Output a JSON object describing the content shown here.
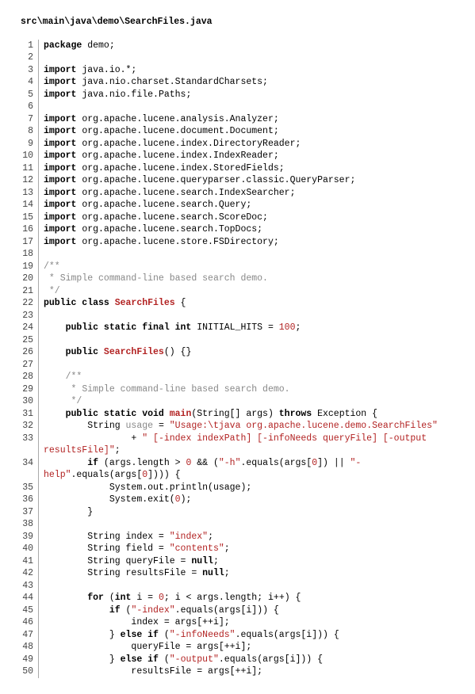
{
  "filePath": "src\\main\\java\\demo\\SearchFiles.java",
  "code": {
    "lines": [
      {
        "n": 1,
        "segs": [
          {
            "t": "package",
            "c": "kw"
          },
          {
            "t": " demo;"
          }
        ]
      },
      {
        "n": 2,
        "segs": []
      },
      {
        "n": 3,
        "segs": [
          {
            "t": "import",
            "c": "kw"
          },
          {
            "t": " java.io.*;"
          }
        ]
      },
      {
        "n": 4,
        "segs": [
          {
            "t": "import",
            "c": "kw"
          },
          {
            "t": " java.nio.charset.StandardCharsets;"
          }
        ]
      },
      {
        "n": 5,
        "segs": [
          {
            "t": "import",
            "c": "kw"
          },
          {
            "t": " java.nio.file.Paths;"
          }
        ]
      },
      {
        "n": 6,
        "segs": []
      },
      {
        "n": 7,
        "segs": [
          {
            "t": "import",
            "c": "kw"
          },
          {
            "t": " org.apache.lucene.analysis.Analyzer;"
          }
        ]
      },
      {
        "n": 8,
        "segs": [
          {
            "t": "import",
            "c": "kw"
          },
          {
            "t": " org.apache.lucene.document.Document;"
          }
        ]
      },
      {
        "n": 9,
        "segs": [
          {
            "t": "import",
            "c": "kw"
          },
          {
            "t": " org.apache.lucene.index.DirectoryReader;"
          }
        ]
      },
      {
        "n": 10,
        "segs": [
          {
            "t": "import",
            "c": "kw"
          },
          {
            "t": " org.apache.lucene.index.IndexReader;"
          }
        ]
      },
      {
        "n": 11,
        "segs": [
          {
            "t": "import",
            "c": "kw"
          },
          {
            "t": " org.apache.lucene.index.StoredFields;"
          }
        ]
      },
      {
        "n": 12,
        "segs": [
          {
            "t": "import",
            "c": "kw"
          },
          {
            "t": " org.apache.lucene.queryparser.classic.QueryParser;"
          }
        ]
      },
      {
        "n": 13,
        "segs": [
          {
            "t": "import",
            "c": "kw"
          },
          {
            "t": " org.apache.lucene.search.IndexSearcher;"
          }
        ]
      },
      {
        "n": 14,
        "segs": [
          {
            "t": "import",
            "c": "kw"
          },
          {
            "t": " org.apache.lucene.search.Query;"
          }
        ]
      },
      {
        "n": 15,
        "segs": [
          {
            "t": "import",
            "c": "kw"
          },
          {
            "t": " org.apache.lucene.search.ScoreDoc;"
          }
        ]
      },
      {
        "n": 16,
        "segs": [
          {
            "t": "import",
            "c": "kw"
          },
          {
            "t": " org.apache.lucene.search.TopDocs;"
          }
        ]
      },
      {
        "n": 17,
        "segs": [
          {
            "t": "import",
            "c": "kw"
          },
          {
            "t": " org.apache.lucene.store.FSDirectory;"
          }
        ]
      },
      {
        "n": 18,
        "segs": []
      },
      {
        "n": 19,
        "segs": [
          {
            "t": "/**",
            "c": "cmt"
          }
        ]
      },
      {
        "n": 20,
        "segs": [
          {
            "t": " * Simple command-line based search demo.",
            "c": "cmt"
          }
        ]
      },
      {
        "n": 21,
        "segs": [
          {
            "t": " */",
            "c": "cmt"
          }
        ]
      },
      {
        "n": 22,
        "segs": [
          {
            "t": "public class ",
            "c": "kw"
          },
          {
            "t": "SearchFiles",
            "c": "cname"
          },
          {
            "t": " {"
          }
        ]
      },
      {
        "n": 23,
        "segs": []
      },
      {
        "n": 24,
        "segs": [
          {
            "t": "    "
          },
          {
            "t": "public static final int",
            "c": "kw"
          },
          {
            "t": " INITIAL_HITS = "
          },
          {
            "t": "100",
            "c": "num"
          },
          {
            "t": ";"
          }
        ]
      },
      {
        "n": 25,
        "segs": []
      },
      {
        "n": 26,
        "segs": [
          {
            "t": "    "
          },
          {
            "t": "public ",
            "c": "kw"
          },
          {
            "t": "SearchFiles",
            "c": "cname"
          },
          {
            "t": "() {}"
          }
        ]
      },
      {
        "n": 27,
        "segs": []
      },
      {
        "n": 28,
        "segs": [
          {
            "t": "    "
          },
          {
            "t": "/**",
            "c": "cmt"
          }
        ]
      },
      {
        "n": 29,
        "segs": [
          {
            "t": "     * Simple command-line based search demo.",
            "c": "cmt"
          }
        ]
      },
      {
        "n": 30,
        "segs": [
          {
            "t": "     */",
            "c": "cmt"
          }
        ]
      },
      {
        "n": 31,
        "segs": [
          {
            "t": "    "
          },
          {
            "t": "public static void ",
            "c": "kw"
          },
          {
            "t": "main",
            "c": "cname"
          },
          {
            "t": "(String[] args) "
          },
          {
            "t": "throws",
            "c": "kw"
          },
          {
            "t": " Exception {"
          }
        ]
      },
      {
        "n": 32,
        "segs": [
          {
            "t": "        String "
          },
          {
            "t": "usage",
            "c": "cmt"
          },
          {
            "t": " = "
          },
          {
            "t": "\"Usage:\\tjava org.apache.lucene.demo.SearchFiles\"",
            "c": "str"
          }
        ]
      },
      {
        "n": 33,
        "segs": [
          {
            "t": "                + "
          },
          {
            "t": "\" [-index indexPath] [-infoNeeds queryFile] [-output resultsFile]\"",
            "c": "str"
          },
          {
            "t": ";"
          }
        ]
      },
      {
        "n": 34,
        "segs": [
          {
            "t": "        "
          },
          {
            "t": "if",
            "c": "kw"
          },
          {
            "t": " (args.length > "
          },
          {
            "t": "0",
            "c": "num"
          },
          {
            "t": " && ("
          },
          {
            "t": "\"-h\"",
            "c": "str"
          },
          {
            "t": ".equals(args["
          },
          {
            "t": "0",
            "c": "num"
          },
          {
            "t": "]) || "
          },
          {
            "t": "\"-help\"",
            "c": "str"
          },
          {
            "t": ".equals(args["
          },
          {
            "t": "0",
            "c": "num"
          },
          {
            "t": "]))) {"
          }
        ]
      },
      {
        "n": 35,
        "segs": [
          {
            "t": "            System.out.println(usage);"
          }
        ]
      },
      {
        "n": 36,
        "segs": [
          {
            "t": "            System.exit("
          },
          {
            "t": "0",
            "c": "num"
          },
          {
            "t": ");"
          }
        ]
      },
      {
        "n": 37,
        "segs": [
          {
            "t": "        }"
          }
        ]
      },
      {
        "n": 38,
        "segs": []
      },
      {
        "n": 39,
        "segs": [
          {
            "t": "        String index = "
          },
          {
            "t": "\"index\"",
            "c": "str"
          },
          {
            "t": ";"
          }
        ]
      },
      {
        "n": 40,
        "segs": [
          {
            "t": "        String field = "
          },
          {
            "t": "\"contents\"",
            "c": "str"
          },
          {
            "t": ";"
          }
        ]
      },
      {
        "n": 41,
        "segs": [
          {
            "t": "        String queryFile = "
          },
          {
            "t": "null",
            "c": "kw"
          },
          {
            "t": ";"
          }
        ]
      },
      {
        "n": 42,
        "segs": [
          {
            "t": "        String resultsFile = "
          },
          {
            "t": "null",
            "c": "kw"
          },
          {
            "t": ";"
          }
        ]
      },
      {
        "n": 43,
        "segs": []
      },
      {
        "n": 44,
        "segs": [
          {
            "t": "        "
          },
          {
            "t": "for",
            "c": "kw"
          },
          {
            "t": " ("
          },
          {
            "t": "int",
            "c": "kw"
          },
          {
            "t": " i = "
          },
          {
            "t": "0",
            "c": "num"
          },
          {
            "t": "; i < args.length; i++) {"
          }
        ]
      },
      {
        "n": 45,
        "segs": [
          {
            "t": "            "
          },
          {
            "t": "if",
            "c": "kw"
          },
          {
            "t": " ("
          },
          {
            "t": "\"-index\"",
            "c": "str"
          },
          {
            "t": ".equals(args[i])) {"
          }
        ]
      },
      {
        "n": 46,
        "segs": [
          {
            "t": "                index = args[++i];"
          }
        ]
      },
      {
        "n": 47,
        "segs": [
          {
            "t": "            } "
          },
          {
            "t": "else if",
            "c": "kw"
          },
          {
            "t": " ("
          },
          {
            "t": "\"-infoNeeds\"",
            "c": "str"
          },
          {
            "t": ".equals(args[i])) {"
          }
        ]
      },
      {
        "n": 48,
        "segs": [
          {
            "t": "                queryFile = args[++i];"
          }
        ]
      },
      {
        "n": 49,
        "segs": [
          {
            "t": "            } "
          },
          {
            "t": "else if",
            "c": "kw"
          },
          {
            "t": " ("
          },
          {
            "t": "\"-output\"",
            "c": "str"
          },
          {
            "t": ".equals(args[i])) {"
          }
        ]
      },
      {
        "n": 50,
        "segs": [
          {
            "t": "                resultsFile = args[++i];"
          }
        ]
      }
    ]
  }
}
